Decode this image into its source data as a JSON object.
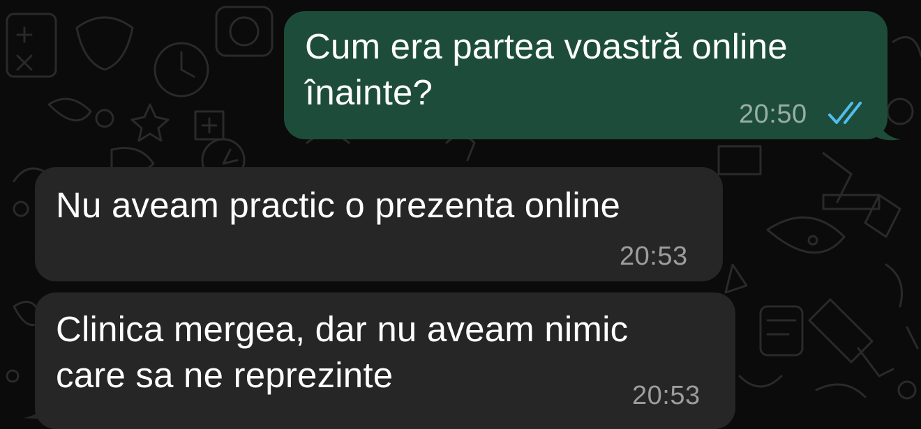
{
  "colors": {
    "background": "#0b0b0b",
    "outgoing_bubble": "#1d4d3a",
    "incoming_bubble": "#262626",
    "read_ticks": "#53bdeb",
    "timestamp": "#a6a6a6"
  },
  "messages": [
    {
      "direction": "outgoing",
      "text": "Cum era partea voastră online\nînainte?",
      "time": "20:50",
      "status_icon": "double-check-read-icon"
    },
    {
      "direction": "incoming",
      "text": "Nu aveam practic o prezenta online",
      "time": "20:53"
    },
    {
      "direction": "incoming",
      "text": "Clinica mergea, dar nu aveam nimic\ncare sa ne reprezinte",
      "time": "20:53"
    }
  ]
}
